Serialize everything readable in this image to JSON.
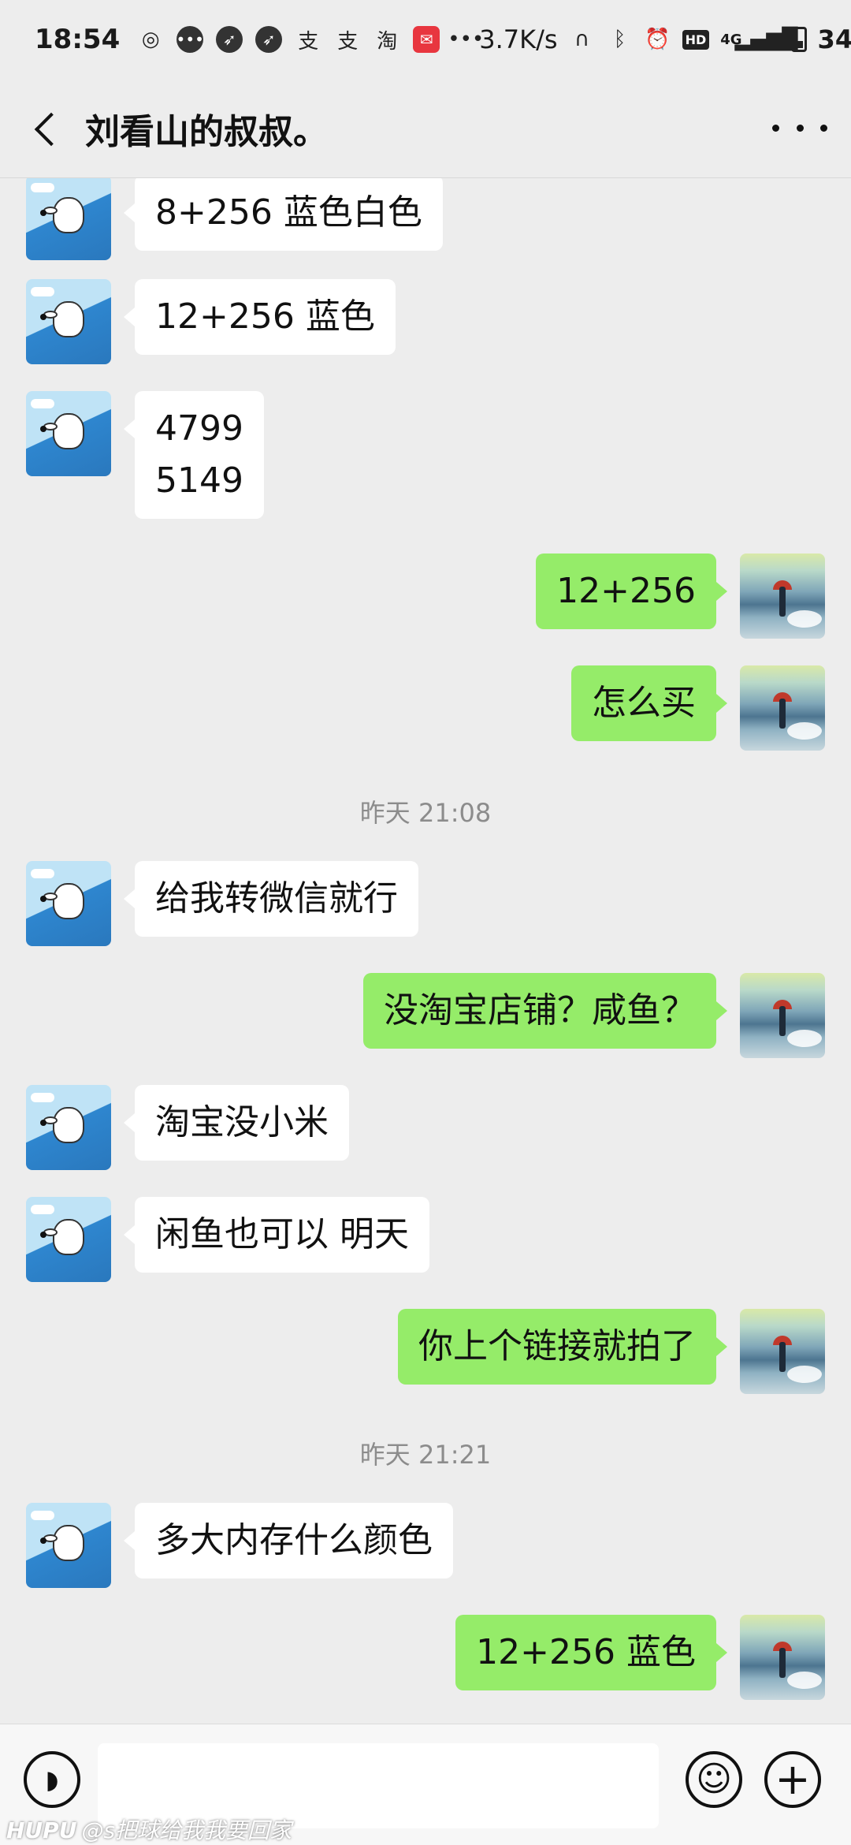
{
  "status_bar": {
    "time": "18:54",
    "net_speed": "3.7K/s",
    "signal_label": "4G",
    "battery": "34%",
    "hd_badge": "HD",
    "icons": [
      "netease-music-icon",
      "message-icon",
      "bird-icon",
      "bird-icon",
      "alipay-icon",
      "alipay-icon",
      "taobao-icon",
      "app-red-icon",
      "more-dots-icon",
      "headphones-icon",
      "bluetooth-icon",
      "alarm-icon"
    ]
  },
  "header": {
    "title": "刘看山的叔叔。"
  },
  "messages": [
    {
      "side": "left",
      "text": "8+256 蓝色白色"
    },
    {
      "side": "left",
      "text": "12+256 蓝色"
    },
    {
      "side": "left",
      "text": "4799\n5149"
    },
    {
      "side": "right",
      "text": "12+256"
    },
    {
      "side": "right",
      "text": "怎么买"
    },
    {
      "timestamp": "昨天 21:08"
    },
    {
      "side": "left",
      "text": "给我转微信就行"
    },
    {
      "side": "right",
      "text": "没淘宝店铺？咸鱼？"
    },
    {
      "side": "left",
      "text": "淘宝没小米"
    },
    {
      "side": "left",
      "text": " 闲鱼也可以 明天"
    },
    {
      "side": "right",
      "text": "你上个链接就拍了"
    },
    {
      "timestamp": "昨天 21:21"
    },
    {
      "side": "left",
      "text": "多大内存什么颜色"
    },
    {
      "side": "right",
      "text": "12+256 蓝色"
    }
  ],
  "input_bar": {
    "value": "",
    "voice_icon": "voice-icon",
    "emoji_icon": "emoji-icon",
    "plus_icon": "plus-icon"
  },
  "watermark": {
    "brand": "HUPU",
    "text": "@s把球给我我要回家"
  }
}
